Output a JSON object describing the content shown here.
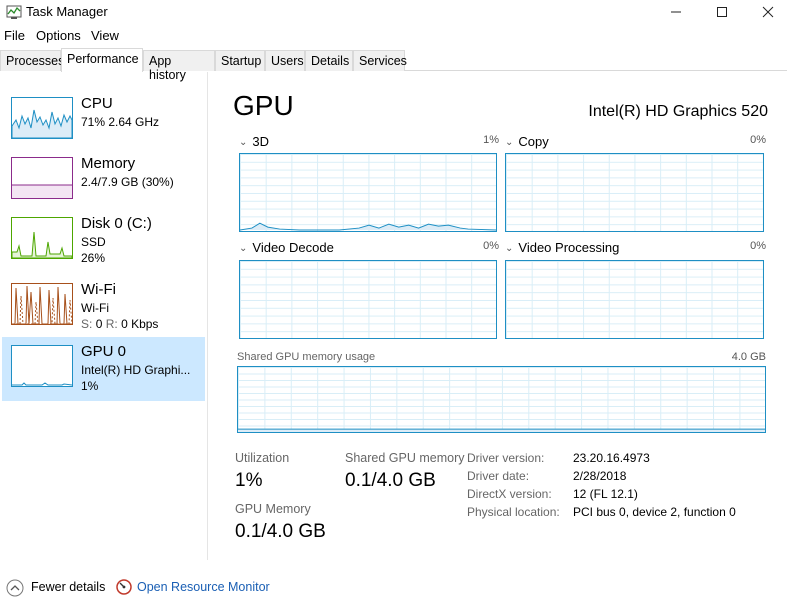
{
  "window": {
    "title": "Task Manager"
  },
  "menu": [
    "File",
    "Options",
    "View"
  ],
  "tabs": [
    "Processes",
    "Performance",
    "App history",
    "Startup",
    "Users",
    "Details",
    "Services"
  ],
  "active_tab": "Performance",
  "sidebar": [
    {
      "title": "CPU",
      "line1": "71%  2.64 GHz",
      "line2": "",
      "color": "#1e8fc4"
    },
    {
      "title": "Memory",
      "line1": "2.4/7.9 GB (30%)",
      "line2": "",
      "color": "#8b2b8b"
    },
    {
      "title": "Disk 0 (C:)",
      "line1": "SSD",
      "line2": "26%",
      "color": "#4da600"
    },
    {
      "title": "Wi-Fi",
      "line1": "Wi-Fi",
      "line2": {
        "s_label": "S:",
        "s_val": "0",
        "r_label": "R:",
        "r_val": "0 Kbps"
      },
      "color": "#a7501b"
    },
    {
      "title": "GPU 0",
      "line1": "Intel(R) HD Graphi...",
      "line2": "1%",
      "color": "#1e8fc4"
    }
  ],
  "main": {
    "title": "GPU",
    "device_name": "Intel(R) HD Graphics 520",
    "engines": [
      {
        "label": "3D",
        "percent": "1%"
      },
      {
        "label": "Copy",
        "percent": "0%"
      },
      {
        "label": "Video Decode",
        "percent": "0%"
      },
      {
        "label": "Video Processing",
        "percent": "0%"
      }
    ],
    "shared_memory": {
      "label": "Shared GPU memory usage",
      "max": "4.0 GB"
    },
    "stats": {
      "utilization_label": "Utilization",
      "utilization_value": "1%",
      "shared_label": "Shared GPU memory",
      "shared_value": "0.1/4.0 GB",
      "gpu_mem_label": "GPU Memory",
      "gpu_mem_value": "0.1/4.0 GB"
    },
    "info": [
      {
        "key": "Driver version:",
        "value": "23.20.16.4973"
      },
      {
        "key": "Driver date:",
        "value": "2/28/2018"
      },
      {
        "key": "DirectX version:",
        "value": "12 (FL 12.1)"
      },
      {
        "key": "Physical location:",
        "value": "PCI bus 0, device 2, function 0"
      }
    ]
  },
  "footer": {
    "fewer_details": "Fewer details",
    "resource_monitor": "Open Resource Monitor"
  },
  "colors": {
    "accent": "#1e8fc4",
    "selected_bg": "#cce8ff",
    "link": "#1a5fb4"
  }
}
